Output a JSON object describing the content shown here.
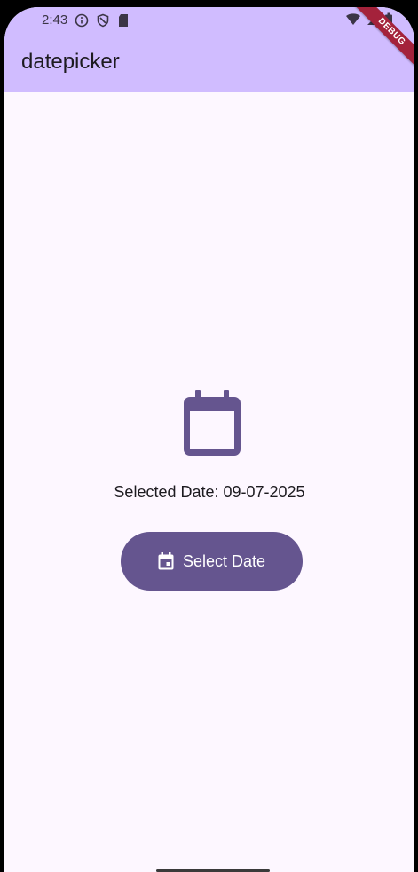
{
  "status_bar": {
    "time": "2:43",
    "left_icons": [
      "info-icon",
      "shield-icon",
      "sd-card-icon"
    ],
    "right_icons": [
      "wifi-icon",
      "signal-icon",
      "battery-icon"
    ]
  },
  "app_bar": {
    "title": "datepicker",
    "debug_banner": "DEBUG",
    "color": "#d0bcff"
  },
  "main": {
    "icon": "calendar-icon",
    "selected_date_text": "Selected Date: 09-07-2025",
    "button": {
      "label": "Select Date",
      "icon": "calendar-event-icon",
      "color": "#65558f"
    }
  },
  "colors": {
    "background": "#fdf7ff",
    "accent": "#65558f"
  }
}
